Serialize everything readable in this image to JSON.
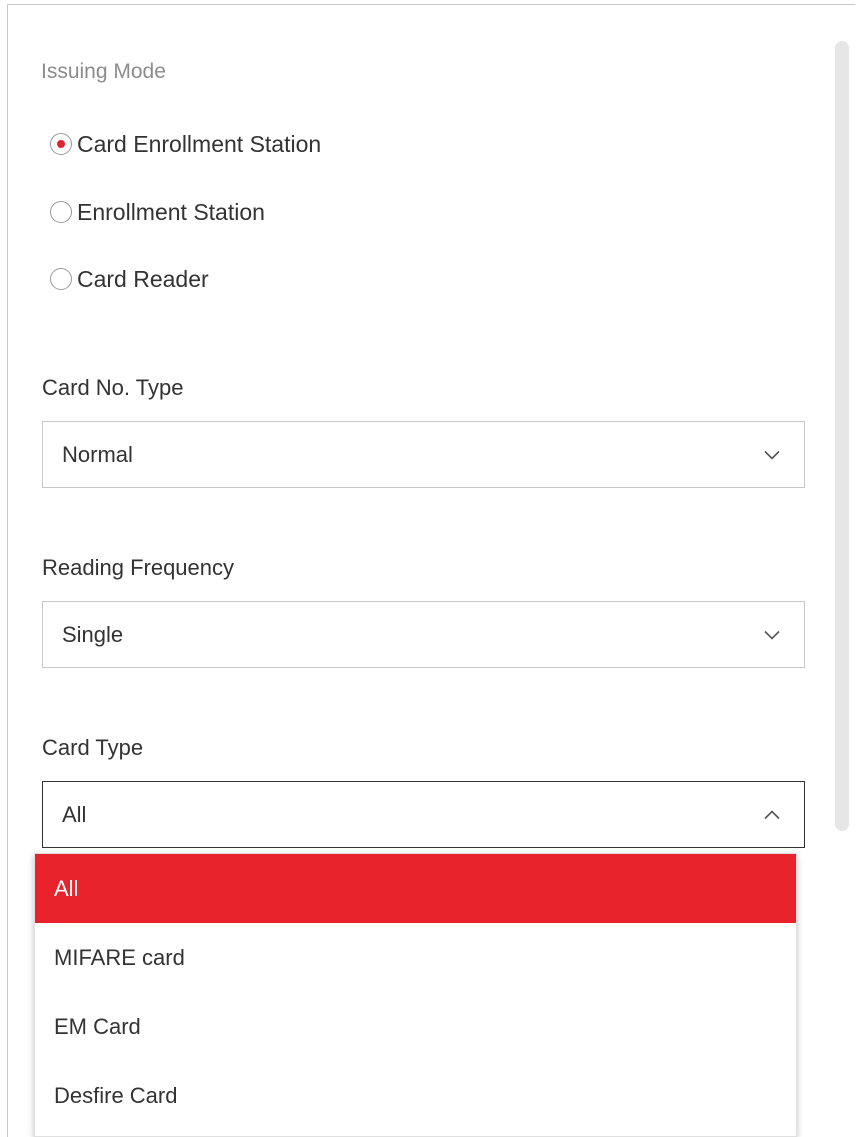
{
  "issuing_mode": {
    "title": "Issuing Mode",
    "options": [
      {
        "label": "Card Enrollment Station",
        "checked": true
      },
      {
        "label": "Enrollment Station",
        "checked": false
      },
      {
        "label": "Card Reader",
        "checked": false
      }
    ]
  },
  "card_no_type": {
    "label": "Card No. Type",
    "value": "Normal",
    "icon": "chevron-down-icon"
  },
  "reading_frequency": {
    "label": "Reading Frequency",
    "value": "Single",
    "icon": "chevron-down-icon"
  },
  "card_type": {
    "label": "Card Type",
    "value": "All",
    "icon": "chevron-up-icon",
    "options": [
      {
        "label": "All",
        "selected": true
      },
      {
        "label": "MIFARE card",
        "selected": false
      },
      {
        "label": "EM Card",
        "selected": false
      },
      {
        "label": "Desfire Card",
        "selected": false
      }
    ]
  },
  "colors": {
    "accent": "#e8232b",
    "text": "#333333",
    "muted": "#8c8c8c",
    "border": "#c8c8c8"
  }
}
